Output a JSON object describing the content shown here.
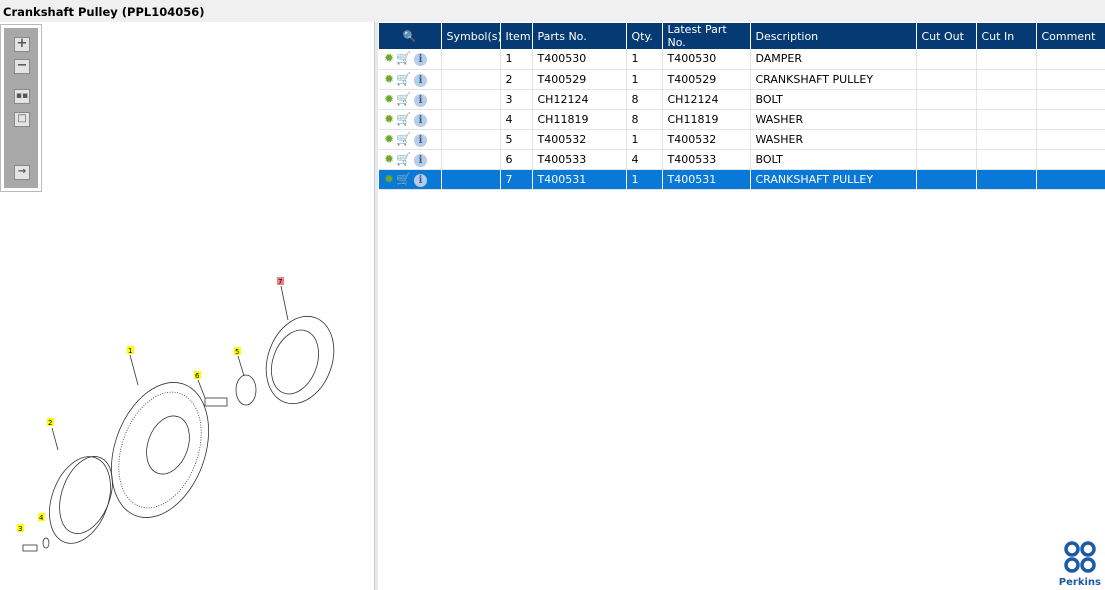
{
  "title": "Crankshaft Pulley (PPL104056)",
  "toolbar": [
    "zoom-in",
    "zoom-out",
    "fit-all",
    "actual-size",
    "toggle-list"
  ],
  "table": {
    "headers": [
      "",
      "Symbol(s)",
      "Item",
      "Parts No.",
      "Qty.",
      "Latest Part No.",
      "Description",
      "Cut Out",
      "Cut In",
      "Comment"
    ],
    "rows": [
      {
        "item": "1",
        "part": "T400530",
        "qty": "1",
        "latest": "T400530",
        "desc": "DAMPER"
      },
      {
        "item": "2",
        "part": "T400529",
        "qty": "1",
        "latest": "T400529",
        "desc": "CRANKSHAFT PULLEY"
      },
      {
        "item": "3",
        "part": "CH12124",
        "qty": "8",
        "latest": "CH12124",
        "desc": "BOLT"
      },
      {
        "item": "4",
        "part": "CH11819",
        "qty": "8",
        "latest": "CH11819",
        "desc": "WASHER"
      },
      {
        "item": "5",
        "part": "T400532",
        "qty": "1",
        "latest": "T400532",
        "desc": "WASHER"
      },
      {
        "item": "6",
        "part": "T400533",
        "qty": "4",
        "latest": "T400533",
        "desc": "BOLT"
      },
      {
        "item": "7",
        "part": "T400531",
        "qty": "1",
        "latest": "T400531",
        "desc": "CRANKSHAFT PULLEY"
      }
    ],
    "selected_index": 6
  },
  "callouts": [
    "1",
    "2",
    "3",
    "4",
    "5",
    "6",
    "7"
  ],
  "logo": "Perkins"
}
